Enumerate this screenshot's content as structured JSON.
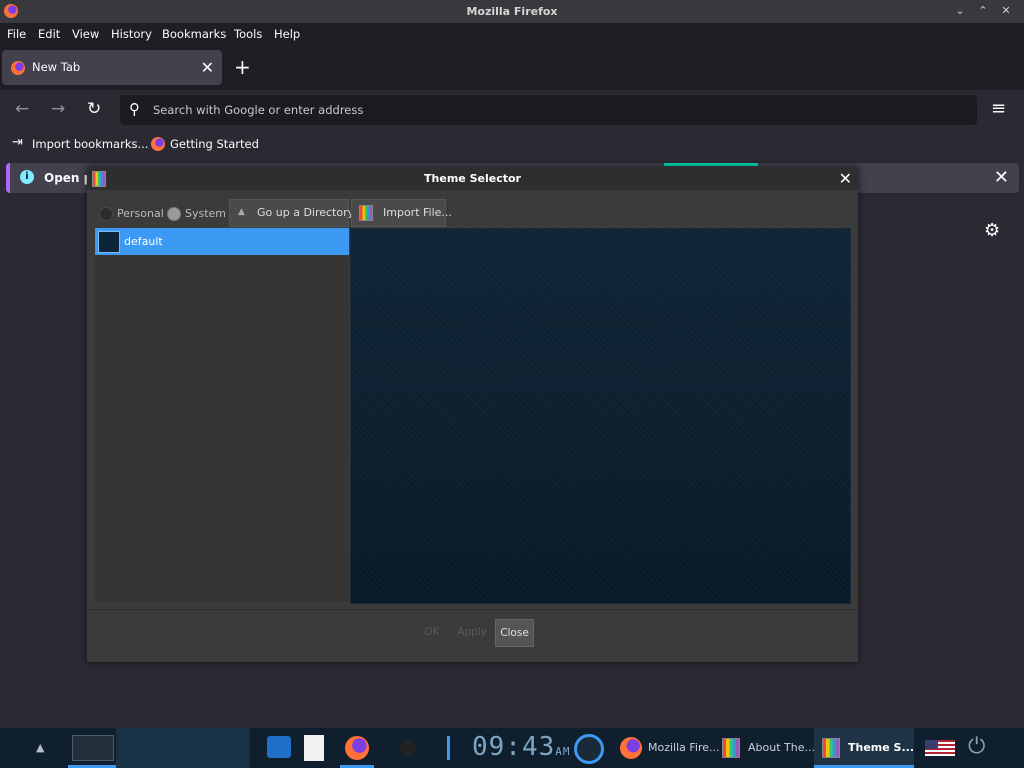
{
  "window": {
    "title": "Mozilla Firefox",
    "controls": {
      "minimize": "⌄",
      "maximize": "⌃",
      "close": "✕"
    }
  },
  "menubar": {
    "items": [
      "File",
      "Edit",
      "View",
      "History",
      "Bookmarks",
      "Tools",
      "Help"
    ]
  },
  "tabs": {
    "active_tab_label": "New Tab",
    "close_glyph": "✕",
    "new_tab_glyph": "+"
  },
  "navbar": {
    "back_glyph": "←",
    "forward_glyph": "→",
    "reload_glyph": "↻",
    "search_glyph": "⚲",
    "url_placeholder": "Search with Google or enter address",
    "menu_glyph": "≡"
  },
  "bookmarks": {
    "items": [
      "Import bookmarks...",
      "Getting Started"
    ]
  },
  "notification": {
    "text": "Open p",
    "info_glyph": "i",
    "close_glyph": "✕"
  },
  "content": {
    "settings_glyph": "⚙"
  },
  "dialog": {
    "title": "Theme Selector",
    "close_glyph": "✕",
    "radios": {
      "personal": "Personal",
      "system": "System"
    },
    "buttons": {
      "up": "Go up a Directory",
      "import": "Import File..."
    },
    "up_glyph": "▲",
    "themes": [
      {
        "name": "default",
        "selected": true
      }
    ],
    "footer": {
      "ok": "OK",
      "apply": "Apply",
      "close": "Close"
    }
  },
  "taskbar": {
    "up_glyph": "▲",
    "clock": {
      "time": "09:43",
      "ampm": "AM"
    },
    "windows": [
      {
        "label": "Mozilla Fire..."
      },
      {
        "label": "About The..."
      },
      {
        "label": "Theme S...",
        "active": true
      }
    ],
    "power_glyph": "⏻"
  },
  "colors": {
    "accent": "#3d9af4",
    "firefox_bg": "#2b2a33",
    "dialog_bg": "#3b3b3b"
  }
}
